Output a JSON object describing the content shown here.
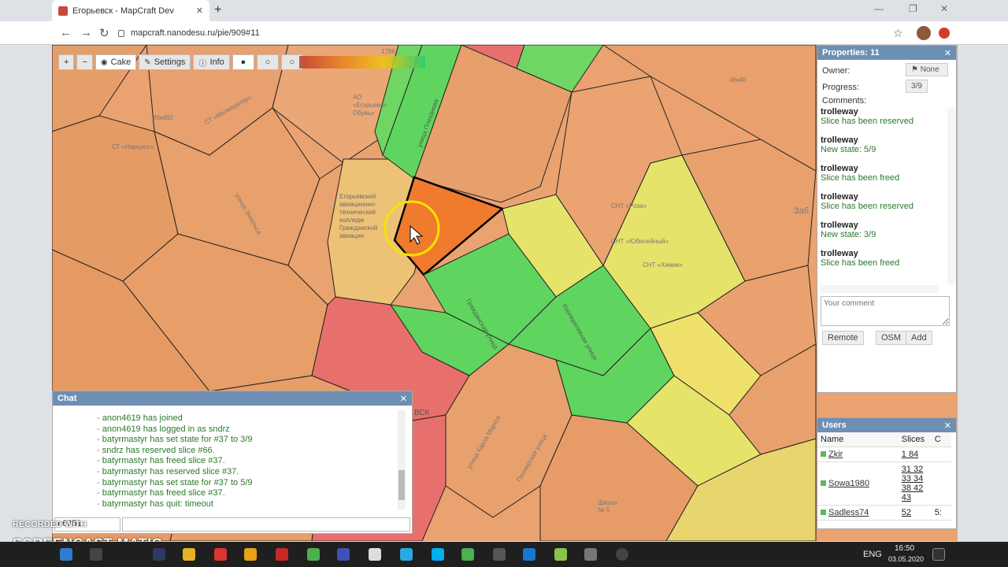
{
  "browser": {
    "tab_title": "Егорьевск - MapCraft Dev",
    "tab_close": "✕",
    "new_tab": "+",
    "url": "mapcraft.nanodesu.ru/pie/909#11",
    "nav": {
      "back": "←",
      "forward": "→",
      "reload": "↻"
    },
    "window": {
      "minimize": "—",
      "maximize": "❐",
      "close": "✕"
    },
    "star": "☆"
  },
  "toolbar": {
    "zoom_in": "+",
    "zoom_out": "−",
    "cake": "Cake",
    "settings": "Settings",
    "info": "Info",
    "mode1": "●",
    "mode2": "○",
    "mode3": "○"
  },
  "properties": {
    "title": "Properties: 11",
    "close": "✕",
    "owner_label": "Owner:",
    "owner_value": "None",
    "progress_label": "Progress:",
    "progress_value": "3/9",
    "comments_label": "Comments:",
    "comments": [
      {
        "user": "trolleway",
        "text": "Slice has been reserved"
      },
      {
        "user": "trolleway",
        "text": "New state: 5/9"
      },
      {
        "user": "trolleway",
        "text": "Slice has been freed"
      },
      {
        "user": "trolleway",
        "text": "Slice has been reserved"
      },
      {
        "user": "trolleway",
        "text": "New state: 3/9"
      },
      {
        "user": "trolleway",
        "text": "Slice has been freed"
      }
    ],
    "comment_placeholder": "Your comment",
    "btn_remote": "Remote",
    "btn_osm": "OSM",
    "btn_add": "Add"
  },
  "users": {
    "title": "Users",
    "close": "✕",
    "col_name": "Name",
    "col_slices": "Slices",
    "col_c": "C",
    "rows": [
      {
        "name": "Zkir",
        "slices": "1 84",
        "c": ""
      },
      {
        "name": "Sowa1980",
        "slices": "31 32 33 34 38 42 43",
        "c": ""
      },
      {
        "name": "Sadless74",
        "slices": "52",
        "c": "5:"
      }
    ]
  },
  "chat": {
    "title": "Chat",
    "close": "✕",
    "messages": [
      "anon4619 has joined",
      "anon4619 has logged in as sndrz",
      "batyrmastyr has set state for #37 to 3/9",
      "sndrz has reserved slice #66.",
      "batyrmastyr has freed slice #37.",
      "batyrmastyr has reserved slice #37.",
      "batyrmastyr has set state for #37 to 5/9",
      "batyrmastyr has freed slice #37.",
      "batyrmastyr has quit: timeout"
    ],
    "name_value": "n6051"
  },
  "watermark": {
    "line1": "RECORDED WITH",
    "line2": "SCREENCAST MATIC"
  },
  "map_labels": {
    "street1": "улица Плеханова",
    "college": "Егорьевский авиационно- технический колледж Гражданской авиации",
    "street2": "Гражданская улица",
    "street3": "Кооперативная улица",
    "snt1": "СНТ «Роза»",
    "snt2": "СНТ «Юбилейный»",
    "snt3": "СНТ «Химик»",
    "school": "Школа № 5",
    "city": "Заб",
    "city2": "ВСК",
    "street4": "улица Карла Маркса",
    "street5": "Пионерская улица",
    "ao": "АО «Егорьевск- Обувь»",
    "cta": "СТ «Мелиоратор»",
    "ctn": "СТ «Нарцисс»",
    "ul6": "улица Энгельса",
    "b1796": "1796",
    "b462": "46к462",
    "b4": "46к46"
  },
  "taskbar": {
    "lang": "ENG",
    "time": "16:50",
    "date": "03.05.2020"
  },
  "colors": {
    "map_bg": "#e9a270",
    "green": "#5fd55f",
    "yellow": "#e6e36a",
    "red": "#e8706c",
    "selected": "#f07a2e",
    "panel_head": "#6d8fb4"
  }
}
